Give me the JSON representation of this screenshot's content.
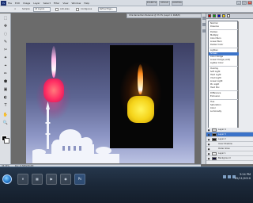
{
  "menubar": {
    "logo": "Ps",
    "items": [
      "File",
      "Edit",
      "Image",
      "Layer",
      "Select",
      "Filter",
      "View",
      "Window",
      "Help"
    ],
    "workspace_buttons": [
      "ESSENTIALS",
      "DESIGN",
      "PAINTING"
    ],
    "window_controls": [
      "_",
      "□",
      "x"
    ]
  },
  "options": {
    "sample_label": "Sample:",
    "sample_value": "All Layers",
    "antialias": "Anti-alias",
    "contiguous": "Contiguous",
    "refine": "Refine Edge..."
  },
  "document": {
    "tab_title": "Xtra Ramadhan Mubarak @ 33.3% (Layer 4, RGB/8)"
  },
  "tools": [
    "⬚",
    "✥",
    "◌",
    "✎",
    "✂",
    "✦",
    "⌖",
    "✏",
    "⬟",
    "▣",
    "◐",
    "T",
    "✋",
    "🔍"
  ],
  "blend_menu": {
    "groups": [
      [
        "Normal",
        "Dissolve"
      ],
      [
        "Darken",
        "Multiply",
        "Color Burn",
        "Linear Burn",
        "Darker Color"
      ],
      [
        "Lighten",
        "Screen",
        "Color Dodge",
        "Linear Dodge (Add)",
        "Lighter Color"
      ],
      [
        "Overlay",
        "Soft Light",
        "Hard Light",
        "Vivid Light",
        "Linear Light",
        "Pin Light",
        "Hard Mix"
      ],
      [
        "Difference",
        "Exclusion"
      ],
      [
        "Hue",
        "Saturation",
        "Color",
        "Luminosity"
      ]
    ],
    "selected": "Screen"
  },
  "layers": {
    "rows": [
      {
        "name": "Layer 4",
        "active": false,
        "thumb": "#d9d9d9"
      },
      {
        "name": "Layer 3",
        "active": true,
        "thumb": "#0a0a0a"
      },
      {
        "name": "Layer 2",
        "active": false,
        "thumb": "#1a1a1a"
      },
      {
        "name": "Inner Shadow",
        "active": false,
        "thumb": "#cfcfcf"
      },
      {
        "name": "Outer Glow",
        "active": false,
        "thumb": "#cfcfcf"
      },
      {
        "name": "Layer 1",
        "active": false,
        "thumb": "#eeeeee"
      },
      {
        "name": "Background",
        "active": false,
        "thumb": "#0b0b30"
      }
    ]
  },
  "status": {
    "zoom": "33.33%",
    "doc_info": "Doc: 8.58M/28.6M"
  },
  "taskbar": {
    "buttons": [
      "e",
      "▦",
      "▶",
      "◉",
      "Ps"
    ],
    "time": "3:24 PM",
    "date": "05/11/2010"
  },
  "colors": {
    "accent": "#3b73c9",
    "canvas_top": "#3c3f63",
    "canvas_bottom": "#bcc3e3",
    "candle_left": "#ff2e63",
    "candle_right": "#f5d41a"
  }
}
